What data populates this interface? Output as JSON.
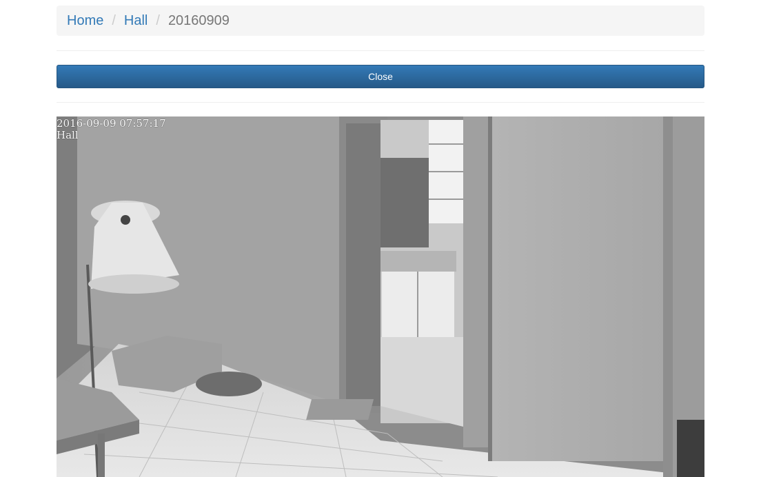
{
  "breadcrumb": {
    "items": [
      {
        "label": "Home"
      },
      {
        "label": "Hall"
      }
    ],
    "separator": "/",
    "active": "20160909"
  },
  "close_button": {
    "label": "Close"
  },
  "camera": {
    "timestamp": "2016-09-09 07:57:17",
    "location": "Hall"
  },
  "colors": {
    "link": "#337ab7",
    "button": "#286090",
    "breadcrumb_bg": "#f5f5f5"
  }
}
